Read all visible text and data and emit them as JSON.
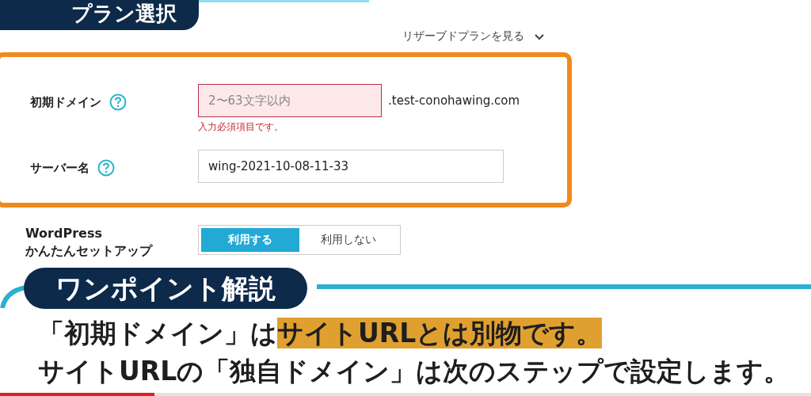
{
  "section_badge": "プラン選択",
  "reserved_link": "リザーブドプランを見る",
  "fields": [
    {
      "label": "初期ドメイン",
      "placeholder": "2〜63文字以内",
      "suffix": ".test-conohawing.com",
      "error": "入力必須項目です。",
      "invalid": true
    },
    {
      "label": "サーバー名",
      "value": "wing-2021-10-08-11-33",
      "invalid": false
    }
  ],
  "wordpress": {
    "label_lines": [
      "WordPress",
      "かんたんセットアップ"
    ],
    "options": [
      {
        "label": "利用する",
        "selected": true
      },
      {
        "label": "利用しない",
        "selected": false
      }
    ]
  },
  "caption_badge": "ワンポイント解説",
  "caption_lines": [
    [
      {
        "text": "「初期ドメイン」は",
        "highlight": false
      },
      {
        "text": "サイトURLとは別物です。",
        "highlight": true
      }
    ],
    [
      {
        "text": "サイトURLの「独自ドメイン」は次のステップで設定します。",
        "highlight": false
      }
    ]
  ],
  "video_progress": {
    "level": 0.19
  }
}
